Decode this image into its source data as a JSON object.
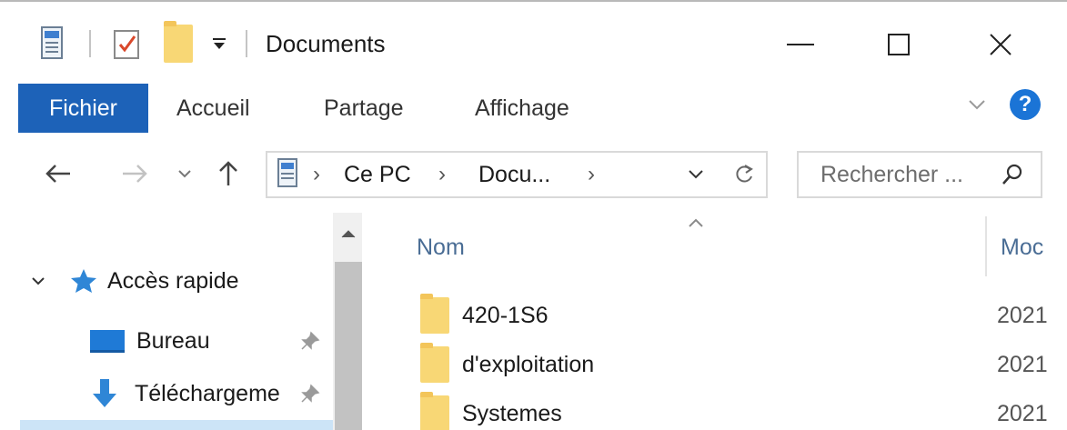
{
  "window": {
    "title": "Documents",
    "minimize_glyph": "—",
    "maximize_glyph": "☐",
    "close_glyph": "✕",
    "icons": [
      "properties-icon",
      "new-folder-icon",
      "folder-icon",
      "customize-toolbar-icon"
    ]
  },
  "ribbon": {
    "tabs": [
      {
        "label": "Fichier"
      },
      {
        "label": "Accueil"
      },
      {
        "label": "Partage"
      },
      {
        "label": "Affichage"
      }
    ],
    "help_glyph": "?",
    "accent": "#1d62b8"
  },
  "address_bar": {
    "crumbs": [
      "Ce PC",
      "Docu..."
    ],
    "separator": "›"
  },
  "search": {
    "placeholder": "Rechercher ..."
  },
  "nav_pane": {
    "items": [
      {
        "label": "Accès rapide",
        "icon": "star-icon"
      },
      {
        "label": "Bureau",
        "icon": "desktop-icon",
        "pinned": true
      },
      {
        "label": "Téléchargeme",
        "icon": "download-icon",
        "pinned": true
      }
    ]
  },
  "columns": {
    "name": "Nom",
    "modified": "Moc"
  },
  "files": [
    {
      "name": "420-1S6",
      "date": "2021"
    },
    {
      "name": "d'exploitation",
      "date": "2021"
    },
    {
      "name": "Systemes",
      "date": "2021"
    }
  ]
}
